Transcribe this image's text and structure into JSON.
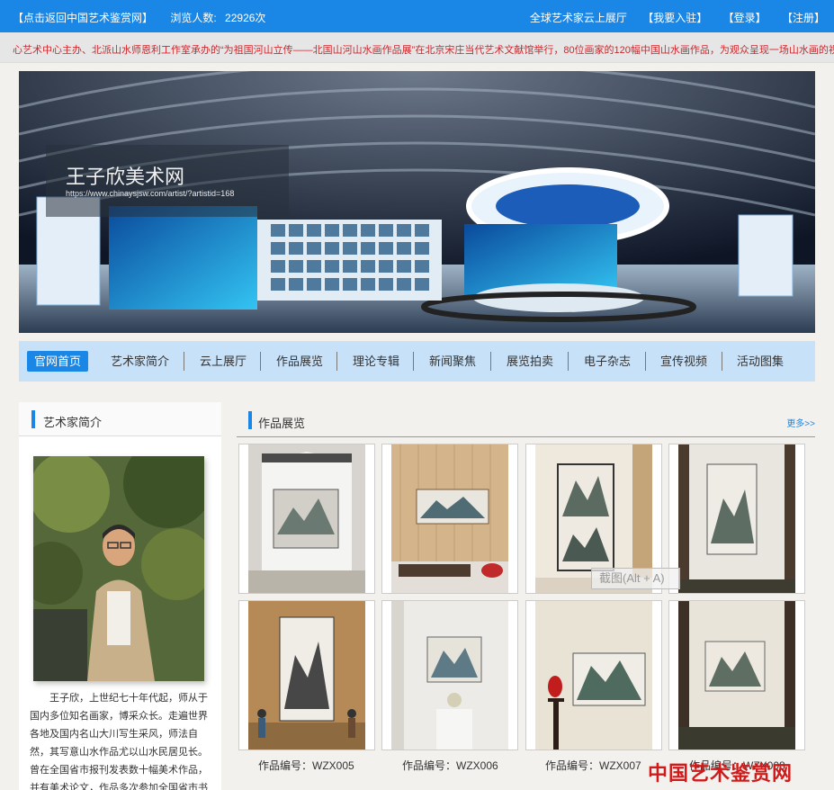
{
  "topbar": {
    "back_link": "【点击返回中国艺术鉴赏网】",
    "visits_label": "浏览人数:",
    "visits_count": "22926次",
    "cloud_hall": "全球艺术家云上展厅",
    "join": "【我要入驻】",
    "login": "【登录】",
    "register": "【注册】"
  },
  "marquee": {
    "text": "心艺术中心主办、北派山水师恩利工作室承办的“为祖国河山立传——北国山河山水画作品展”在北京宋庄当代艺术文献馆举行，80位画家的120幅中国山水画作品，为观众呈现一场山水画的视觉盛宴"
  },
  "banner": {
    "title": "王子欣美术网",
    "url": "https://www.chinaysjsw.com/artist/?artistid=168"
  },
  "nav": {
    "items": [
      "官网首页",
      "艺术家简介",
      "云上展厅",
      "作品展览",
      "理论专辑",
      "新闻聚焦",
      "展览拍卖",
      "电子杂志",
      "宣传视频",
      "活动图集"
    ]
  },
  "sidebar": {
    "heading": "艺术家简介",
    "bio": "王子欣，上世纪七十年代起，师从于国内多位知名画家，博采众长。走遍世界各地及国内名山大川写生采风，师法自然，其写意山水作品尤以山水民居见长。曾在全国省市报刊发表数十幅美术作品，并有美术论文，作品多次参加全国省市书画展，多次获奖并被收藏。"
  },
  "works": {
    "heading": "作品展览",
    "more": "更多>>",
    "captions": [
      "作品编号：WZX005",
      "作品编号：WZX006",
      "作品编号：WZX007",
      "作品编号：WZX008"
    ]
  },
  "overlay": {
    "screenshot_tip": "截图(Alt + A)",
    "watermark": "中国艺术鉴赏网"
  },
  "colors": {
    "accent": "#1a87e6",
    "nav_bg": "#c7e1f8",
    "marquee_text": "#d0262b",
    "watermark": "#d21a1a"
  }
}
